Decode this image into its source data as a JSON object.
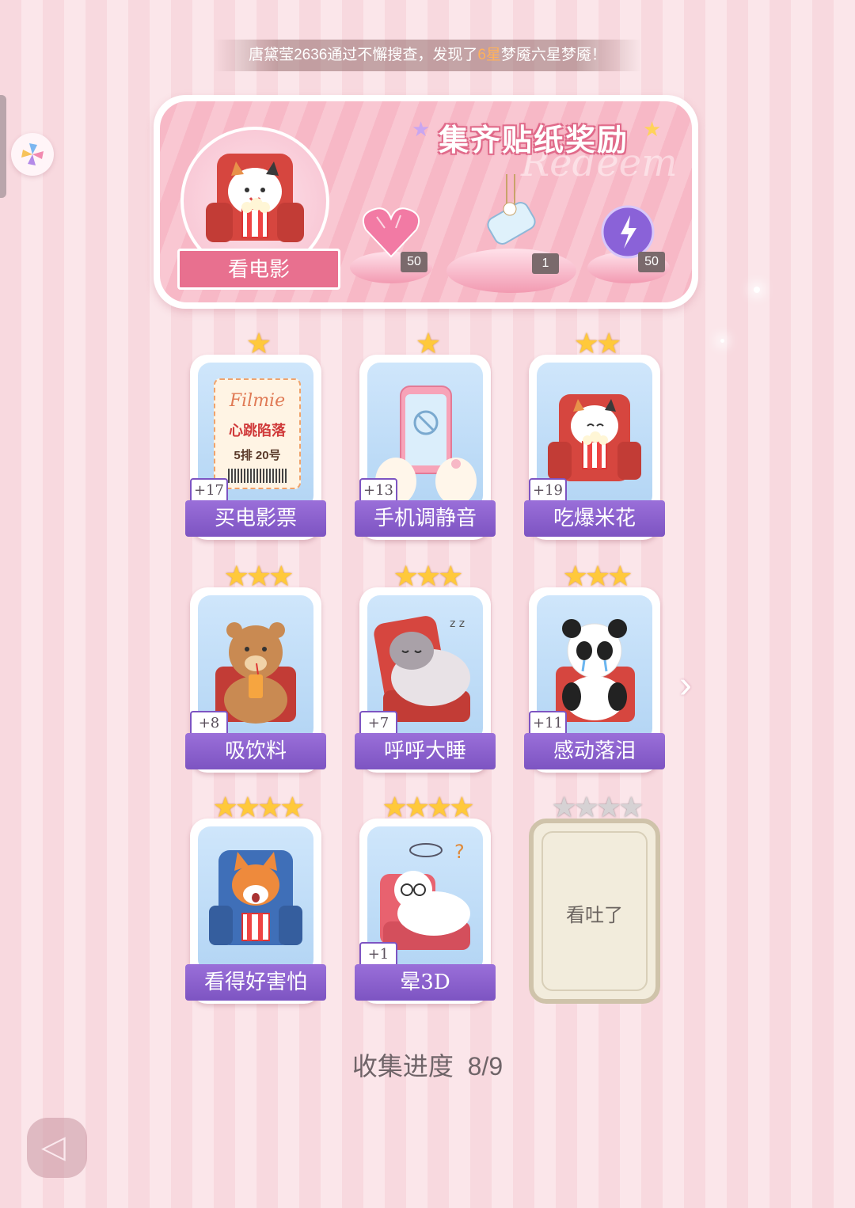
{
  "notice": {
    "pre": "唐黛莹2636通过不懈搜查，发现了",
    "highlight": "6星",
    "post": "梦魇六星梦魇！"
  },
  "banner": {
    "title": "集齐贴纸奖励",
    "watermark": "Redeem",
    "topic_label": "看电影",
    "rewards": [
      {
        "name": "pink-heart-gem",
        "count": "50"
      },
      {
        "name": "wind-chime-bottle",
        "count": "1"
      },
      {
        "name": "purple-energy-orb",
        "count": "50"
      }
    ]
  },
  "cards": [
    {
      "label": "买电影票",
      "bonus": "+17",
      "stars": 1,
      "art": "ticket",
      "ticket": {
        "brand": "Filmie",
        "movie": "心跳陷落",
        "seat": "5排 20号"
      }
    },
    {
      "label": "手机调静音",
      "bonus": "+13",
      "stars": 1,
      "art": "phone"
    },
    {
      "label": "吃爆米花",
      "bonus": "+19",
      "stars": 2,
      "art": "cat"
    },
    {
      "label": "吸饮料",
      "bonus": "+8",
      "stars": 3,
      "art": "bear"
    },
    {
      "label": "呼呼大睡",
      "bonus": "+7",
      "stars": 3,
      "art": "hamster"
    },
    {
      "label": "感动落泪",
      "bonus": "+11",
      "stars": 3,
      "art": "panda"
    },
    {
      "label": "看得好害怕",
      "bonus": "",
      "stars": 4,
      "art": "fox"
    },
    {
      "label": "晕3D",
      "bonus": "+1",
      "stars": 4,
      "art": "dizzycat"
    },
    {
      "label": "看吐了",
      "bonus": "",
      "stars": 4,
      "art": "locked",
      "locked": true
    }
  ],
  "progress": {
    "label": "收集进度",
    "value": "8/9"
  },
  "colors": {
    "caption": "#8a5fd0",
    "star": "#ffc93b",
    "banner": "#f7b8c6"
  }
}
